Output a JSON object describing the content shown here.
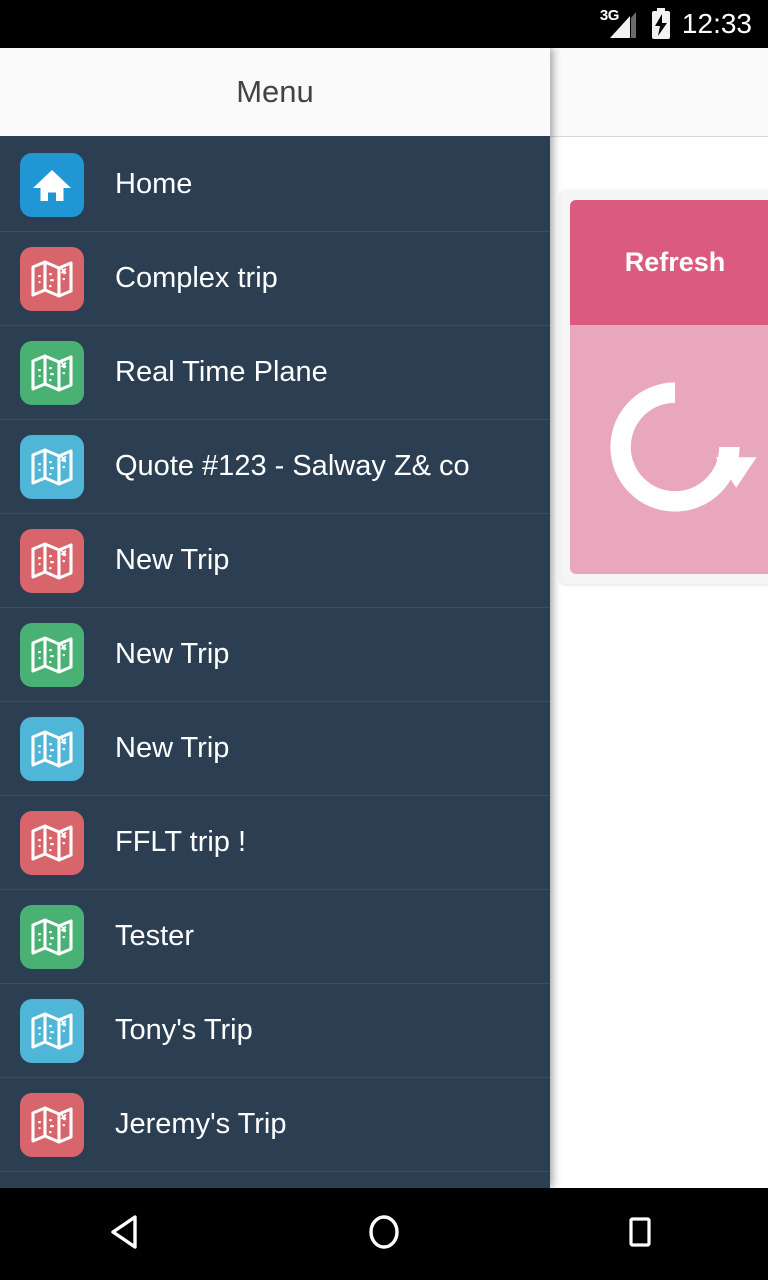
{
  "statusbar": {
    "network_label": "3G",
    "signal_icon": "signal-bars-icon",
    "battery_icon": "battery-charging-icon",
    "clock": "12:33"
  },
  "drawer": {
    "title": "Menu",
    "items": [
      {
        "label": "Home",
        "icon": "home-icon",
        "color": "#2196D4"
      },
      {
        "label": "Complex trip",
        "icon": "map-icon",
        "color": "#D8656B"
      },
      {
        "label": "Real Time Plane",
        "icon": "map-icon",
        "color": "#49B173"
      },
      {
        "label": "Quote #123 - Salway Z& co",
        "icon": "map-icon",
        "color": "#4FB6D8"
      },
      {
        "label": "New Trip",
        "icon": "map-icon",
        "color": "#D8656B"
      },
      {
        "label": "New Trip",
        "icon": "map-icon",
        "color": "#49B173"
      },
      {
        "label": "New Trip",
        "icon": "map-icon",
        "color": "#4FB6D8"
      },
      {
        "label": "FFLT trip !",
        "icon": "map-icon",
        "color": "#D8656B"
      },
      {
        "label": "Tester",
        "icon": "map-icon",
        "color": "#49B173"
      },
      {
        "label": "Tony's Trip",
        "icon": "map-icon",
        "color": "#4FB6D8"
      },
      {
        "label": "Jeremy's Trip",
        "icon": "map-icon",
        "color": "#D8656B"
      }
    ]
  },
  "content": {
    "refresh_card": {
      "header_label": "Refresh",
      "header_color": "#DB5A80",
      "body_color": "#E8A7BC",
      "icon": "refresh-circle-icon"
    }
  },
  "navbar": {
    "back_icon": "back-triangle-icon",
    "home_icon": "home-circle-icon",
    "recents_icon": "recents-square-icon"
  }
}
